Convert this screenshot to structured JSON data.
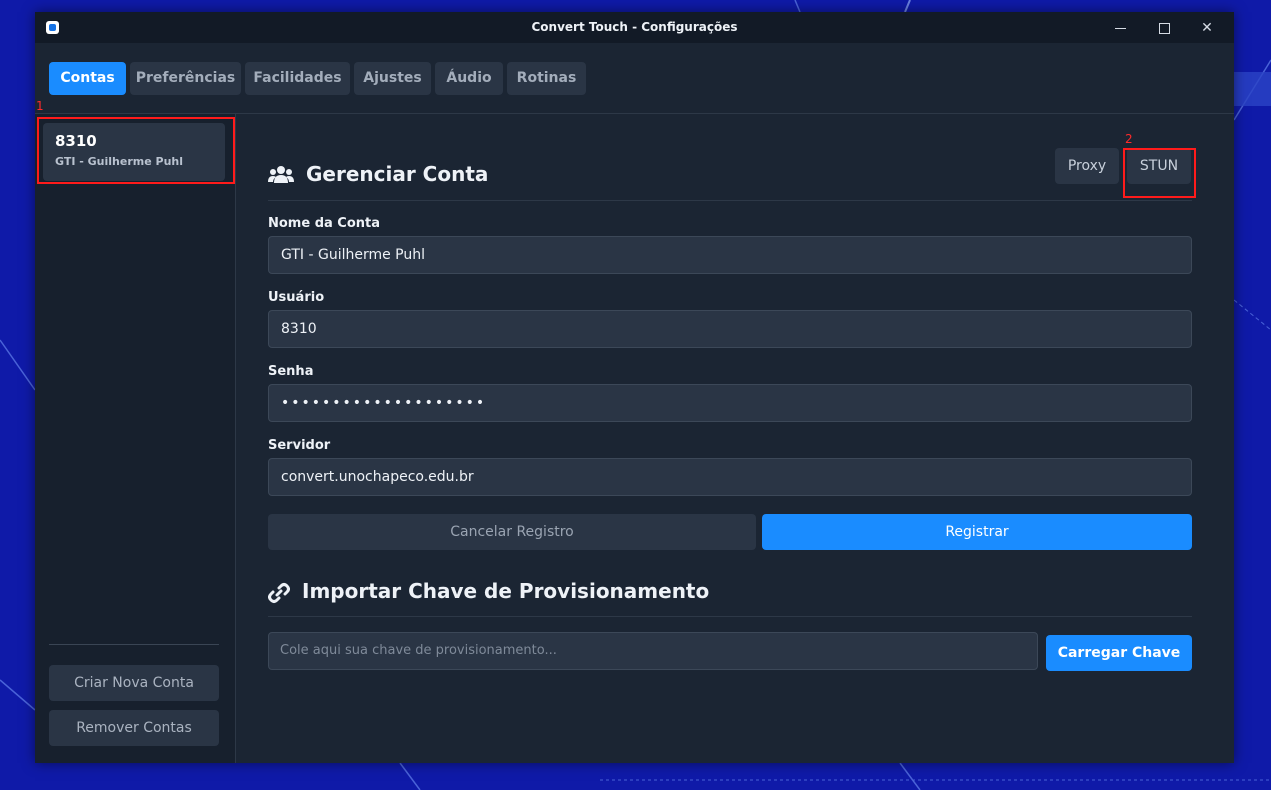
{
  "window": {
    "title": "Convert Touch - Configurações"
  },
  "tabs": [
    {
      "label": "Contas",
      "active": true
    },
    {
      "label": "Preferências"
    },
    {
      "label": "Facilidades"
    },
    {
      "label": "Ajustes"
    },
    {
      "label": "Áudio"
    },
    {
      "label": "Rotinas"
    }
  ],
  "sidebar": {
    "account": {
      "number": "8310",
      "name": "GTI - Guilherme Puhl"
    },
    "create_label": "Criar Nova Conta",
    "remove_label": "Remover Contas"
  },
  "annotations": {
    "one": "1",
    "two": "2"
  },
  "manage": {
    "title": "Gerenciar Conta",
    "proxy_label": "Proxy",
    "stun_label": "STUN",
    "account_name_label": "Nome da Conta",
    "account_name_value": "GTI - Guilherme Puhl",
    "user_label": "Usuário",
    "user_value": "8310",
    "password_label": "Senha",
    "password_value": "••••••••••••••••••••",
    "server_label": "Servidor",
    "server_value": "convert.unochapeco.edu.br",
    "cancel_label": "Cancelar Registro",
    "register_label": "Registrar"
  },
  "provision": {
    "title": "Importar Chave de Provisionamento",
    "placeholder": "Cole aqui sua chave de provisionamento...",
    "load_label": "Carregar Chave"
  },
  "colors": {
    "accent": "#1a8cff",
    "highlight": "#ff1b1b",
    "window_bg": "#1b2533"
  }
}
